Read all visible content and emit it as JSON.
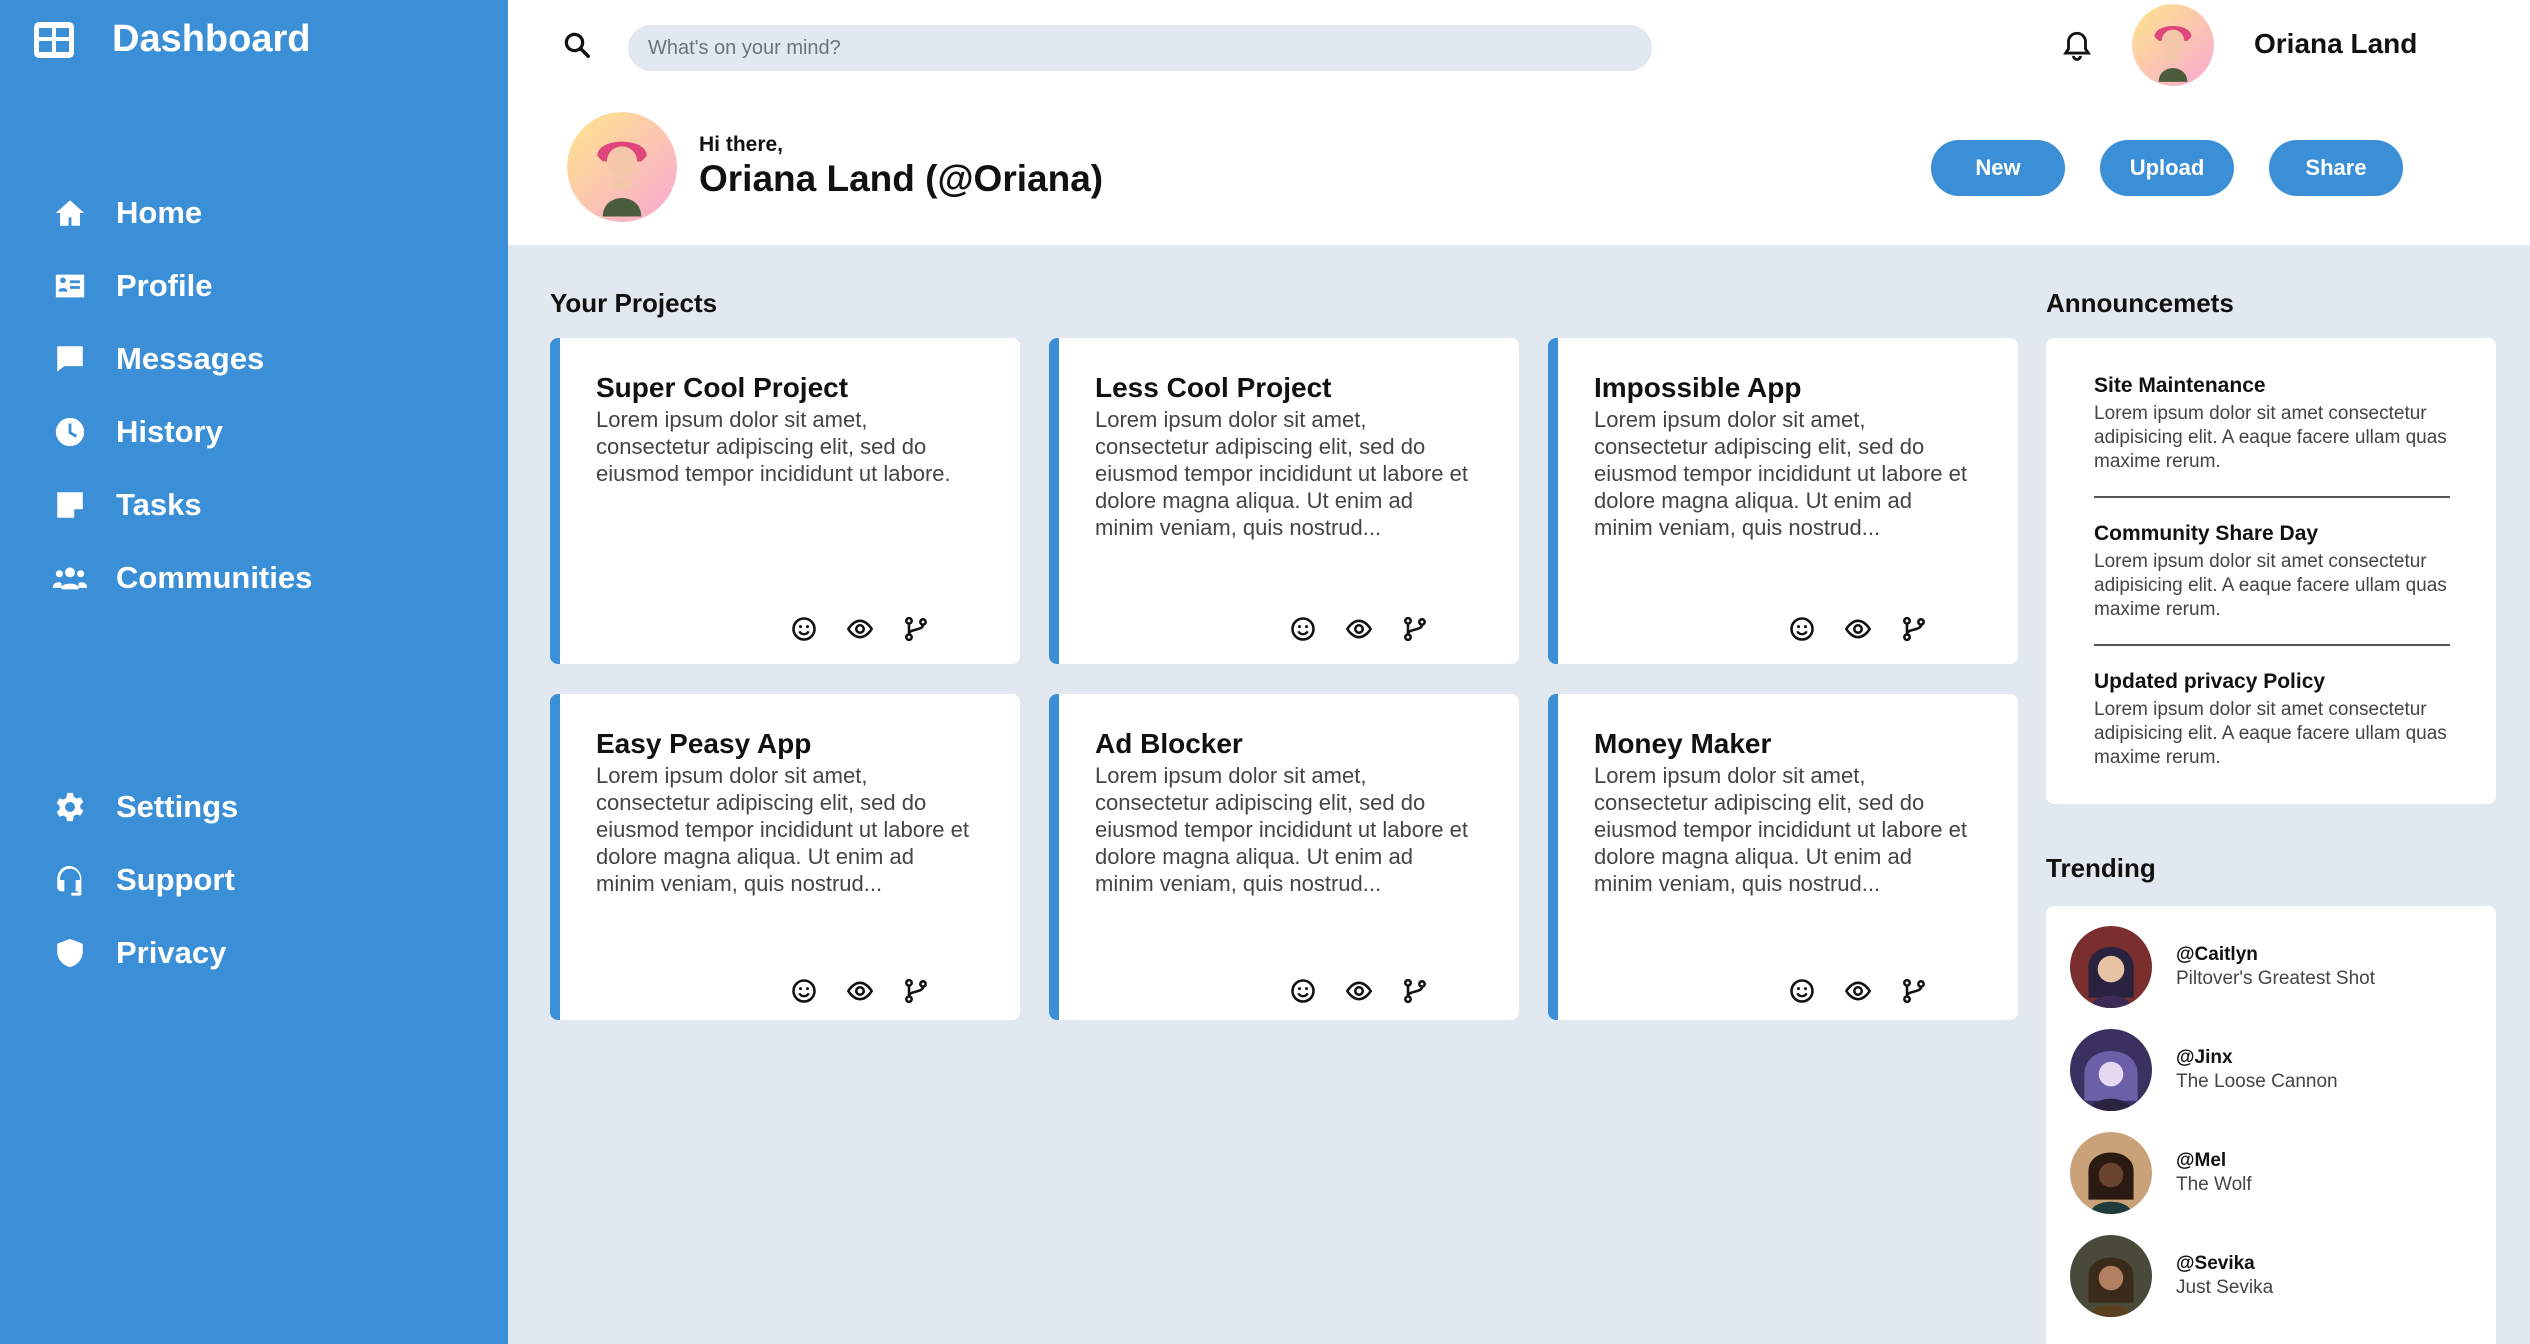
{
  "sidebar": {
    "brand": {
      "title": "Dashboard",
      "icon": "dashboard-icon"
    },
    "nav_top": [
      {
        "label": "Home",
        "icon": "home-icon"
      },
      {
        "label": "Profile",
        "icon": "id-card-icon"
      },
      {
        "label": "Messages",
        "icon": "message-icon"
      },
      {
        "label": "History",
        "icon": "clock-icon"
      },
      {
        "label": "Tasks",
        "icon": "note-icon"
      },
      {
        "label": "Communities",
        "icon": "users-icon"
      }
    ],
    "nav_bottom": [
      {
        "label": "Settings",
        "icon": "gear-icon"
      },
      {
        "label": "Support",
        "icon": "headset-icon"
      },
      {
        "label": "Privacy",
        "icon": "shield-icon"
      }
    ]
  },
  "header": {
    "search_placeholder": "What's on your mind?",
    "user_name": "Oriana Land",
    "greeting_small": "Hi there,",
    "greeting_big": "Oriana Land (@Oriana)",
    "buttons": {
      "new": "New",
      "upload": "Upload",
      "share": "Share"
    }
  },
  "projects": {
    "title": "Your Projects",
    "items": [
      {
        "title": "Super Cool Project",
        "desc": "Lorem ipsum dolor sit amet, consectetur adipiscing elit, sed do eiusmod tempor incididunt ut labore."
      },
      {
        "title": "Less Cool Project",
        "desc": "Lorem ipsum dolor sit amet, consectetur adipiscing elit, sed do eiusmod tempor incididunt ut labore et dolore magna aliqua. Ut enim ad minim veniam, quis nostrud..."
      },
      {
        "title": "Impossible App",
        "desc": "Lorem ipsum dolor sit amet, consectetur adipiscing elit, sed do eiusmod tempor incididunt ut labore et dolore magna aliqua. Ut enim ad minim veniam, quis nostrud..."
      },
      {
        "title": "Easy Peasy App",
        "desc": "Lorem ipsum dolor sit amet, consectetur adipiscing elit, sed do eiusmod tempor incididunt ut labore et dolore magna aliqua. Ut enim ad minim veniam, quis nostrud..."
      },
      {
        "title": "Ad Blocker",
        "desc": "Lorem ipsum dolor sit amet, consectetur adipiscing elit, sed do eiusmod tempor incididunt ut labore et dolore magna aliqua. Ut enim ad minim veniam, quis nostrud..."
      },
      {
        "title": "Money Maker",
        "desc": "Lorem ipsum dolor sit amet, consectetur adipiscing elit, sed do eiusmod tempor incididunt ut labore et dolore magna aliqua. Ut enim ad minim veniam, quis nostrud..."
      }
    ]
  },
  "announcements": {
    "title": "Announcemets",
    "items": [
      {
        "title": "Site Maintenance",
        "body": "Lorem ipsum dolor sit amet consectetur adipisicing elit. A eaque facere ullam quas maxime rerum."
      },
      {
        "title": "Community Share Day",
        "body": "Lorem ipsum dolor sit amet consectetur adipisicing elit. A eaque facere ullam quas maxime rerum."
      },
      {
        "title": "Updated privacy Policy",
        "body": "Lorem ipsum dolor sit amet consectetur adipisicing elit. A eaque facere ullam quas maxime rerum."
      }
    ]
  },
  "trending": {
    "title": "Trending",
    "items": [
      {
        "handle": "@Caitlyn",
        "desc": "Piltover's Greatest Shot"
      },
      {
        "handle": "@Jinx",
        "desc": "The Loose Cannon"
      },
      {
        "handle": "@Mel",
        "desc": "The Wolf"
      },
      {
        "handle": "@Sevika",
        "desc": "Just Sevika"
      }
    ]
  },
  "colors": {
    "accent": "#3b8fd6",
    "background": "#e2e8f0",
    "panel": "#ffffff"
  }
}
